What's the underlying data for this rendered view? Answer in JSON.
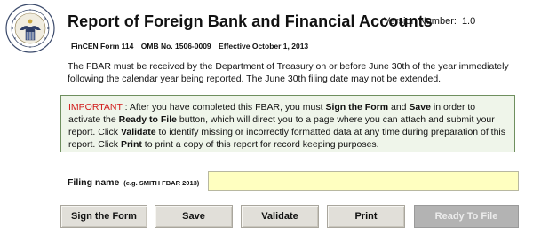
{
  "header": {
    "title": "Report of Foreign Bank and Financial Accounts",
    "version_label": "Version Number:",
    "version_value": "1.0",
    "form_number": "FinCEN Form 114",
    "omb_number": "OMB No. 1506-0009",
    "effective_date": "Effective October 1, 2013",
    "seal_icon": "fincen-seal-icon"
  },
  "intro": {
    "text": "The FBAR must be received by the Department of Treasury on or before June 30th of the year immediately  following the calendar year being reported. The June 30th filing date may not be extended."
  },
  "notice": {
    "important": "IMPORTANT",
    "t1": " : After you have completed this FBAR, you must ",
    "b1": "Sign the Form",
    "t2": " and ",
    "b2": "Save",
    "t3": " in order to activate the ",
    "b3": "Ready to File",
    "t4": " button, which will direct you to a page where you can attach and submit your report. Click ",
    "b4": "Validate",
    "t5": " to identify missing or incorrectly formatted data at any time during preparation of this report. Click ",
    "b5": "Print",
    "t6": " to print a copy of this report for record keeping purposes."
  },
  "filing": {
    "label": "Filing name",
    "hint": "(e.g. SMITH FBAR 2013)",
    "value": ""
  },
  "buttons": {
    "sign": "Sign the Form",
    "save": "Save",
    "validate": "Validate",
    "print": "Print",
    "ready": "Ready To File"
  },
  "colors": {
    "important_red": "#d11a1a",
    "notice_bg": "#eff5ea",
    "notice_border": "#6f8f5f",
    "input_bg": "#ffffc0",
    "button_bg": "#e1dfd9",
    "disabled_button_bg": "#b3b3b3"
  }
}
